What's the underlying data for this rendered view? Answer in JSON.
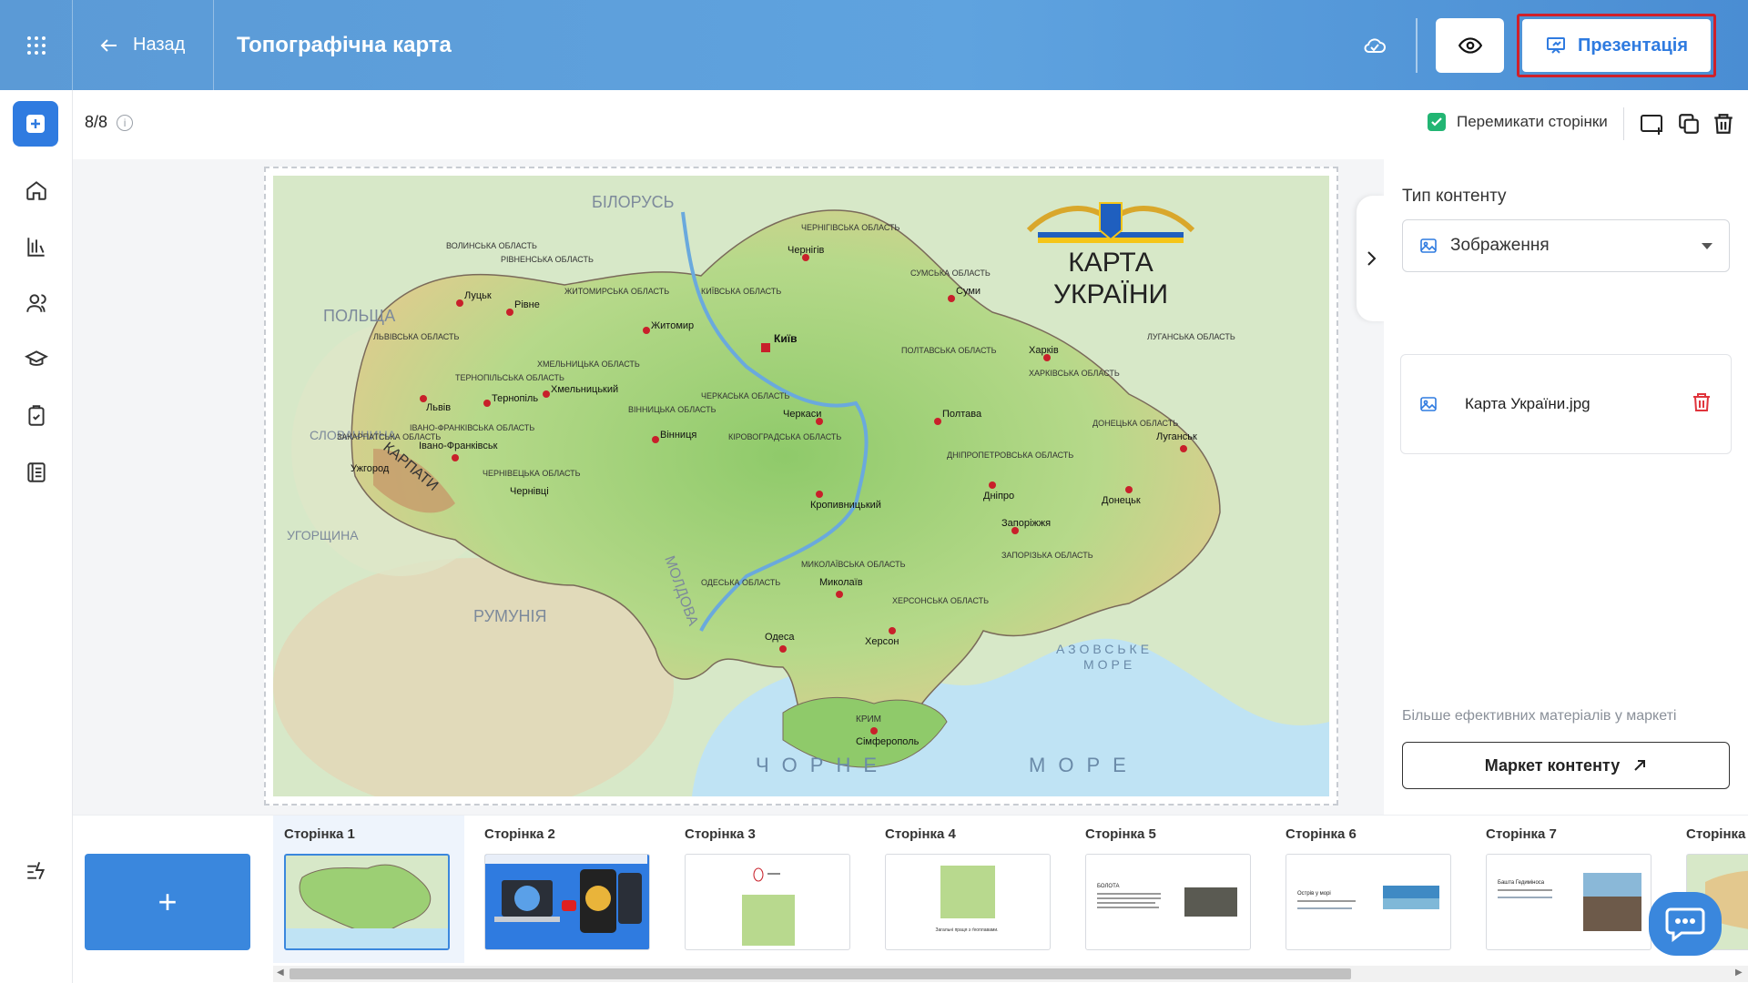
{
  "header": {
    "back_label": "Назад",
    "title": "Топографічна карта",
    "present_label": "Презентація"
  },
  "toolbar": {
    "counter": "8/8",
    "toggle_pages_label": "Перемикати сторінки"
  },
  "map": {
    "title_line1": "КАРТА",
    "title_line2": "УКРАЇНИ",
    "labels": {
      "belarus": "БІЛОРУСЬ",
      "poland": "ПОЛЬЩА",
      "slovakia": "СЛОВАЧЧИНА",
      "hungary": "УГОРЩИНА",
      "romania": "РУМУНІЯ",
      "moldova": "МОЛДОВА",
      "carpathians": "КАРПАТИ",
      "azov": "АЗОВСЬКЕ",
      "azov2": "МОРЕ",
      "black_sea_1": "ЧОРНЕ",
      "black_sea_2": "МОРЕ"
    },
    "cities": [
      "Київ",
      "Харків",
      "Дніпро",
      "Одеса",
      "Львів",
      "Запоріжжя",
      "Херсон",
      "Миколаїв",
      "Полтава",
      "Суми",
      "Чернігів",
      "Житомир",
      "Вінниця",
      "Черкаси",
      "Луцьк",
      "Рівне",
      "Тернопіль",
      "Ужгород",
      "Чернівці",
      "Луганськ",
      "Донецьк",
      "Сімферополь",
      "Кропивницький",
      "Хмельницький",
      "Івано-Франківськ"
    ],
    "regions": [
      "ВОЛИНСЬКА ОБЛАСТЬ",
      "РІВНЕНСЬКА ОБЛАСТЬ",
      "ЖИТОМИРСЬКА ОБЛАСТЬ",
      "КИЇВСЬКА ОБЛАСТЬ",
      "ЧЕРНІГІВСЬКА ОБЛАСТЬ",
      "СУМСЬКА ОБЛАСТЬ",
      "ХАРКІВСЬКА ОБЛАСТЬ",
      "ЛУГАНСЬКА ОБЛАСТЬ",
      "ДОНЕЦЬКА ОБЛАСТЬ",
      "ПОЛТАВСЬКА ОБЛАСТЬ",
      "ЧЕРКАСЬКА ОБЛАСТЬ",
      "ВІННИЦЬКА ОБЛАСТЬ",
      "ХМЕЛЬНИЦЬКА ОБЛАСТЬ",
      "ТЕРНОПІЛЬСЬКА ОБЛАСТЬ",
      "ЛЬВІВСЬКА ОБЛАСТЬ",
      "ІВАНО-ФРАНКІВСЬКА ОБЛАСТЬ",
      "ЗАКАРПАТСЬКА ОБЛАСТЬ",
      "ЧЕРНІВЕЦЬКА ОБЛАСТЬ",
      "КІРОВОГРАДСЬКА ОБЛАСТЬ",
      "ДНІПРОПЕТРОВСЬКА ОБЛАСТЬ",
      "ЗАПОРІЗЬКА ОБЛАСТЬ",
      "МИКОЛАЇВСЬКА ОБЛАСТЬ",
      "ОДЕСЬКА ОБЛАСТЬ",
      "ХЕРСОНСЬКА ОБЛАСТЬ",
      "КРИМ"
    ]
  },
  "panel": {
    "content_type_label": "Тип контенту",
    "content_type_value": "Зображення",
    "file_name": "Карта України.jpg",
    "market_hint": "Більше ефективних матеріалів у маркеті",
    "market_button": "Маркет контенту"
  },
  "pages": [
    {
      "label": "Сторінка 1"
    },
    {
      "label": "Сторінка 2"
    },
    {
      "label": "Сторінка 3"
    },
    {
      "label": "Сторінка 4"
    },
    {
      "label": "Сторінка 5"
    },
    {
      "label": "Сторінка 6"
    },
    {
      "label": "Сторінка 7"
    },
    {
      "label": "Сторінка"
    }
  ],
  "thumbs": {
    "p4_caption": "Загальні праця з ґеоплавами.",
    "p5_title": "БОЛОТА",
    "p6_title": "Острів у морі",
    "p7_title": "Башта Гедиміноса"
  },
  "add_page_symbol": "+",
  "colors": {
    "accent": "#2f7be0",
    "header_gradient": "#5fa3df",
    "highlight_border": "#d0202a",
    "check": "#22b573",
    "delete": "#e0343c"
  }
}
